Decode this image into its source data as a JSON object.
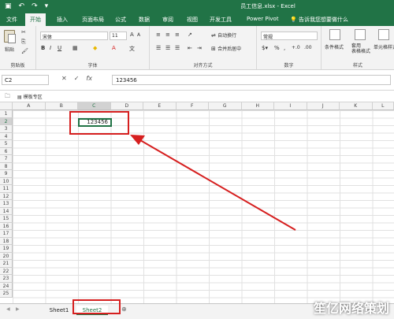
{
  "window": {
    "title": "员工信息.xlsx - Excel"
  },
  "tabs": [
    "文件",
    "开始",
    "插入",
    "页面布局",
    "公式",
    "数据",
    "审阅",
    "视图",
    "开发工具",
    "Power Pivot"
  ],
  "tell_me": "告诉我您想要做什么",
  "ribbon": {
    "clipboard": {
      "label": "剪贴板",
      "paste": "粘贴"
    },
    "font": {
      "label": "字体",
      "font_name": "宋体",
      "font_size": "11"
    },
    "alignment": {
      "label": "对齐方式",
      "wrap_text": "自动换行",
      "merge_center": "合并后居中"
    },
    "number": {
      "label": "数字",
      "format": "常规"
    },
    "styles": {
      "label": "样式",
      "conditional": "条件格式",
      "as_table": "套用\n表格格式",
      "cell_styles": "单元格样式"
    }
  },
  "formula_bar": {
    "name_box": "C2",
    "fx": "fx",
    "value": "123456"
  },
  "favorites": {
    "label": "模板专区"
  },
  "columns": [
    "A",
    "B",
    "C",
    "D",
    "E",
    "F",
    "G",
    "H",
    "I",
    "J",
    "K",
    "L"
  ],
  "rows": [
    "1",
    "2",
    "3",
    "4",
    "5",
    "6",
    "7",
    "8",
    "9",
    "10",
    "11",
    "12",
    "13",
    "14",
    "15",
    "16",
    "17",
    "18",
    "19",
    "20",
    "21",
    "22",
    "23",
    "24",
    "25"
  ],
  "cell": {
    "ref": "C2",
    "value": "123456"
  },
  "sheets": [
    "Sheet1",
    "Sheet2"
  ],
  "active_sheet": "Sheet2",
  "watermark": "笙亿网络策划",
  "colors": {
    "excel_green": "#217346",
    "highlight_red": "#d61f1f"
  }
}
